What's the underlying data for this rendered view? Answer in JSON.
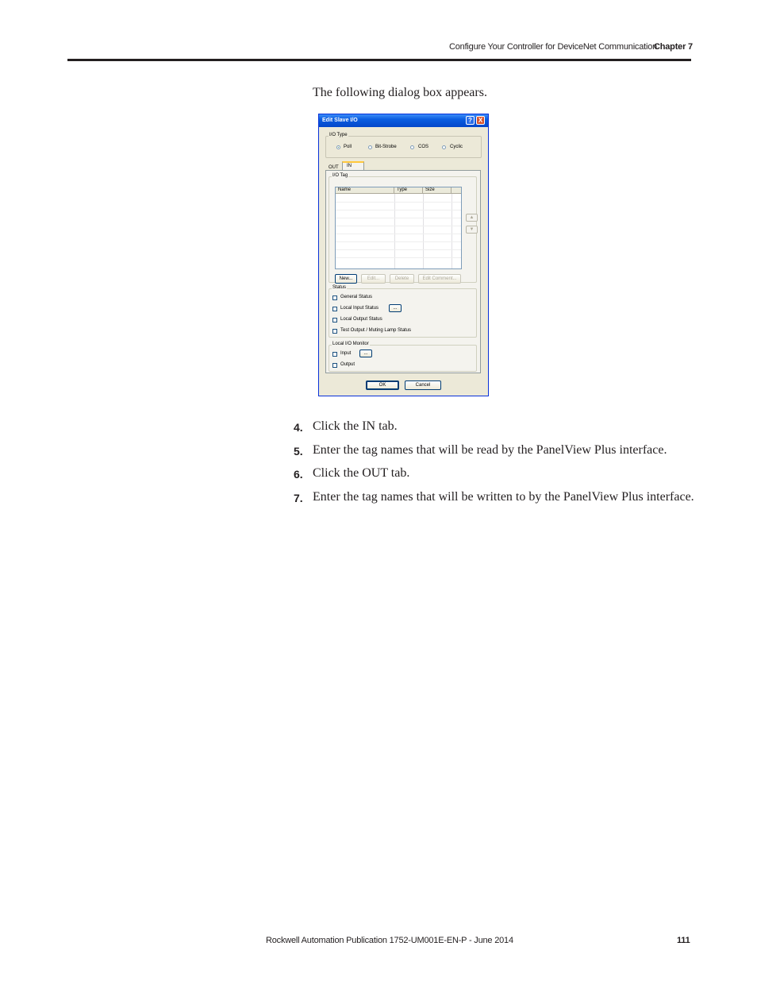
{
  "header": {
    "section_title": "Configure Your Controller for DeviceNet Communication",
    "chapter": "Chapter 7"
  },
  "intro": "The following dialog box appears.",
  "dialog": {
    "title": "Edit Slave I/O",
    "help_icon": "?",
    "close_icon": "X",
    "io_type": {
      "label": "I/O Type",
      "options": [
        "Poll",
        "Bit-Strobe",
        "COS",
        "Cyclic"
      ],
      "selected": "Poll"
    },
    "tabs": [
      "OUT",
      "IN"
    ],
    "active_tab": "IN",
    "io_tag": {
      "label": "I/O Tag",
      "columns": [
        "Name",
        "Type",
        "Size"
      ],
      "up_arrow": "▲",
      "down_arrow": "▼"
    },
    "tag_buttons": {
      "new": "New...",
      "edit": "Edit...",
      "delete": "Delete",
      "edit_comment": "Edit Comment..."
    },
    "status": {
      "label": "Status",
      "items": [
        "General Status",
        "Local Input Status",
        "Local Output Status",
        "Test Output / Muting Lamp Status"
      ],
      "browse": "..."
    },
    "local_io_monitor": {
      "label": "Local I/O Monitor",
      "items": [
        "Input",
        "Output"
      ],
      "browse": "..."
    },
    "ok": "OK",
    "cancel": "Cancel"
  },
  "steps": [
    {
      "num": "4.",
      "text": "Click the IN tab."
    },
    {
      "num": "5.",
      "text": "Enter the tag names that will be read by the PanelView Plus interface."
    },
    {
      "num": "6.",
      "text": "Click the OUT tab."
    },
    {
      "num": "7.",
      "text": "Enter the tag names that will be written to by the PanelView Plus interface."
    }
  ],
  "footer": {
    "publication": "Rockwell Automation Publication 1752-UM001E-EN-P - June 2014",
    "page_number": "111"
  }
}
